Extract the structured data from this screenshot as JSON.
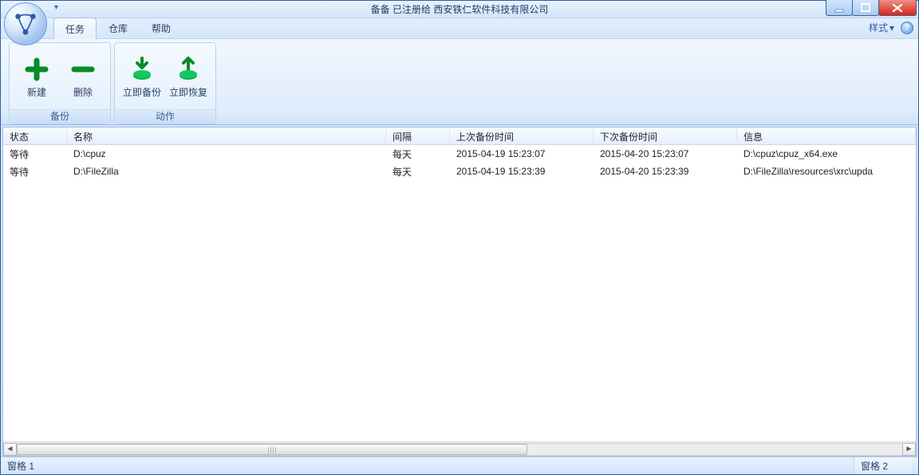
{
  "title": "备备  已注册给  西安铁仁软件科技有限公司",
  "menu": {
    "tabs": [
      "任务",
      "仓库",
      "帮助"
    ],
    "style_label": "样式",
    "active_index": 0
  },
  "ribbon": {
    "groups": [
      {
        "label": "备份",
        "buttons": [
          {
            "name": "new-button",
            "label": "新建",
            "icon": "plus"
          },
          {
            "name": "delete-button",
            "label": "删除",
            "icon": "minus"
          }
        ]
      },
      {
        "label": "动作",
        "buttons": [
          {
            "name": "backup-now-button",
            "label": "立即备份",
            "icon": "down-disk"
          },
          {
            "name": "restore-now-button",
            "label": "立即恢复",
            "icon": "up-disk"
          }
        ]
      }
    ]
  },
  "grid": {
    "columns": [
      "状态",
      "名称",
      "间隔",
      "上次备份时间",
      "下次备份时间",
      "信息"
    ],
    "rows": [
      {
        "status": "等待",
        "name": "D:\\cpuz",
        "interval": "每天",
        "last": "2015-04-19 15:23:07",
        "next": "2015-04-20 15:23:07",
        "info": "D:\\cpuz\\cpuz_x64.exe"
      },
      {
        "status": "等待",
        "name": "D:\\FileZilla",
        "interval": "每天",
        "last": "2015-04-19 15:23:39",
        "next": "2015-04-20 15:23:39",
        "info": "D:\\FileZilla\\resources\\xrc\\upda"
      }
    ]
  },
  "statusbar": {
    "left": "窗格 1",
    "right": "窗格 2"
  }
}
